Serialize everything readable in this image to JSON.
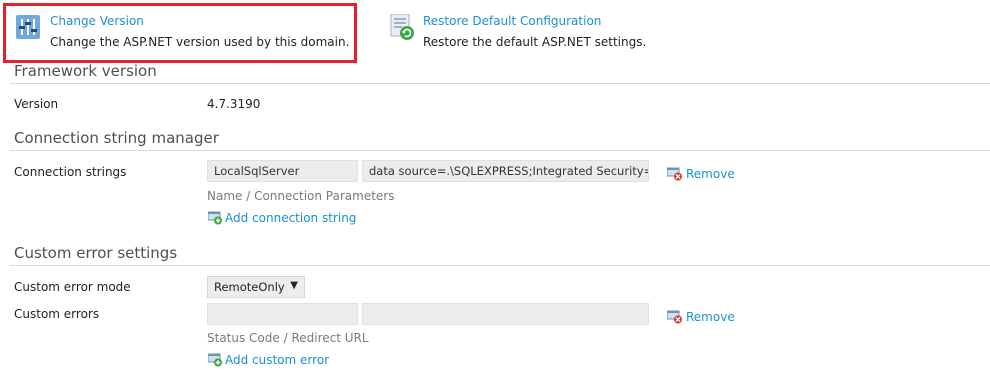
{
  "actions": [
    {
      "title": "Change Version",
      "desc": "Change the ASP.NET version used by this domain."
    },
    {
      "title": "Restore Default Configuration",
      "desc": "Restore the default ASP.NET settings."
    }
  ],
  "framework": {
    "section_title": "Framework version",
    "version_label": "Version",
    "version_value": "4.7.3190"
  },
  "connection": {
    "section_title": "Connection string manager",
    "label": "Connection strings",
    "name_value": "LocalSqlServer",
    "params_value": "data source=.\\SQLEXPRESS;Integrated Security=SSP",
    "remove_label": "Remove",
    "hint": "Name / Connection Parameters",
    "add_label": "Add connection string"
  },
  "custom_errors": {
    "section_title": "Custom error settings",
    "mode_label": "Custom error mode",
    "mode_value": "RemoteOnly",
    "errors_label": "Custom errors",
    "status_code_value": "",
    "redirect_url_value": "",
    "remove_label": "Remove",
    "hint": "Status Code / Redirect URL",
    "add_label": "Add custom error"
  }
}
